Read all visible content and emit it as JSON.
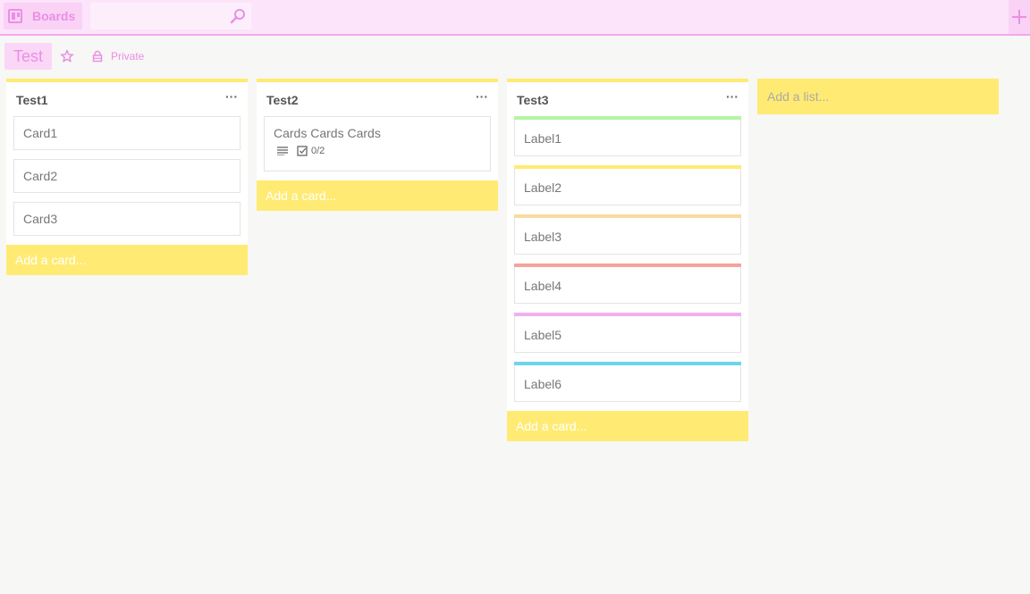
{
  "header": {
    "boards_label": "Boards",
    "search_placeholder": ""
  },
  "board": {
    "title": "Test",
    "privacy_label": "Private"
  },
  "lists": [
    {
      "title": "Test1",
      "menu_label": "···",
      "cards": [
        "Card1",
        "Card2",
        "Card3"
      ],
      "add_card_label": "Add a card..."
    },
    {
      "title": "Test2",
      "menu_label": "···",
      "cards": [
        {
          "title": "Cards Cards Cards",
          "checklist": "0/2",
          "has_description": true
        }
      ],
      "add_card_label": "Add a card..."
    },
    {
      "title": "Test3",
      "menu_label": "···",
      "cards": [
        {
          "title": "Label1",
          "label_color": "#b3f5a0"
        },
        {
          "title": "Label2",
          "label_color": "#ffeb73"
        },
        {
          "title": "Label3",
          "label_color": "#f8dba0"
        },
        {
          "title": "Label4",
          "label_color": "#f4a49a"
        },
        {
          "title": "Label5",
          "label_color": "#f0b0ee"
        },
        {
          "title": "Label6",
          "label_color": "#6dd3ef"
        }
      ],
      "add_card_label": "Add a card..."
    }
  ],
  "add_list_label": "Add a list...",
  "colors": {
    "accent": "#ea8fe4",
    "header_bg": "#fce4fb",
    "list_accent": "#ffeb73",
    "page_bg": "#f7f7f5"
  }
}
